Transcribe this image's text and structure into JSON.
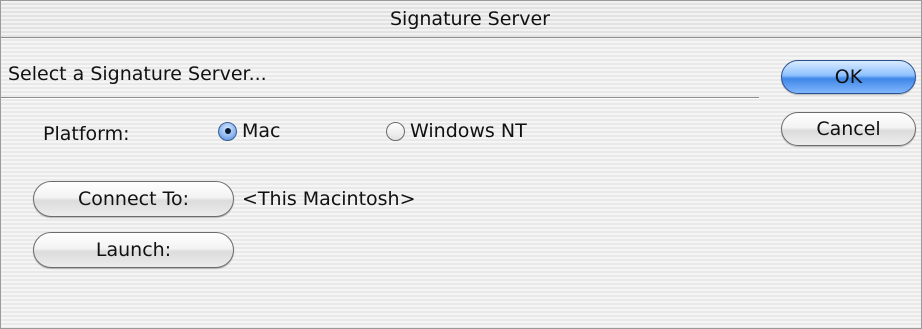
{
  "window": {
    "title": "Signature Server"
  },
  "prompt": "Select a Signature Server...",
  "platform": {
    "label": "Platform:",
    "options": [
      {
        "label": "Mac",
        "selected": true
      },
      {
        "label": "Windows NT",
        "selected": false
      }
    ]
  },
  "buttons": {
    "ok": "OK",
    "cancel": "Cancel",
    "connect_to": "Connect To:",
    "launch": "Launch:"
  },
  "connect_target": "<This Macintosh>",
  "colors": {
    "default_button": "#3f86e6",
    "radio_selected": "#4f86d6"
  },
  "icons": {
    "radio_on": "radio-selected-icon",
    "radio_off": "radio-unselected-icon"
  }
}
